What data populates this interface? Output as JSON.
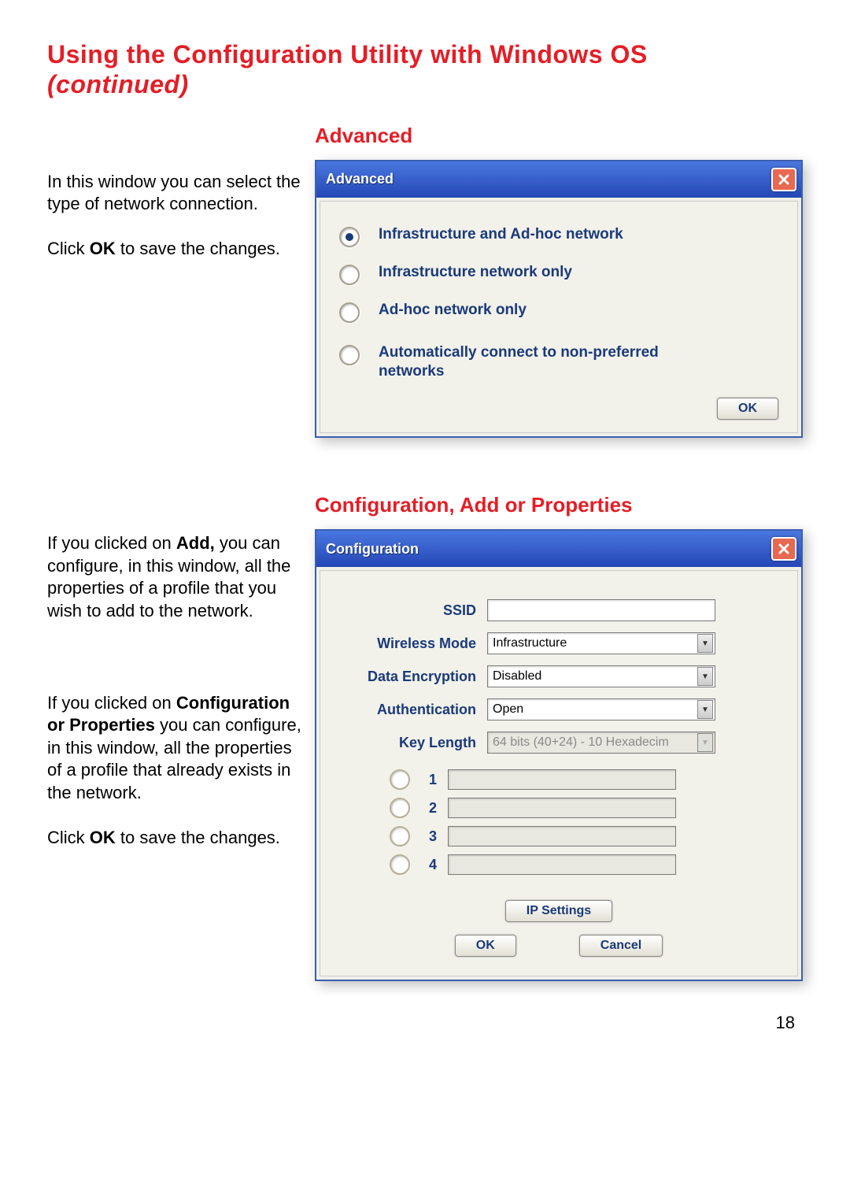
{
  "page": {
    "title_line1": "Using the Configuration Utility with Windows OS",
    "title_line2": "(continued)",
    "number": "18"
  },
  "advanced": {
    "heading": "Advanced",
    "intro_text1": "In this window you can select the type of network connection.",
    "intro_text2a": "Click ",
    "intro_ok": "OK",
    "intro_text2b": " to save the changes.",
    "dialog_title": "Advanced",
    "options": [
      "Infrastructure and Ad-hoc network",
      "Infrastructure  network only",
      "Ad-hoc network only"
    ],
    "option_auto": "Automatically connect to non-preferred networks",
    "ok_button": "OK"
  },
  "config": {
    "heading": "Configuration, Add or Properties",
    "para1_pre": "If you clicked on ",
    "para1_add": "Add,",
    "para1_post": " you can configure, in this window, all the properties of a profile that you wish to add to the network.",
    "para2_pre": "If you clicked on ",
    "para2_cfg": "Configuration or Properties",
    "para2_post": " you can configure, in this window, all the properties of a profile that already exists in the network.",
    "para3_pre": "Click ",
    "para3_ok": "OK",
    "para3_post": " to save the changes.",
    "dialog_title": "Configuration",
    "labels": {
      "ssid": "SSID",
      "wmode": "Wireless Mode",
      "enc": "Data Encryption",
      "auth": "Authentication",
      "klen": "Key Length"
    },
    "values": {
      "ssid": "",
      "wmode": "Infrastructure",
      "enc": "Disabled",
      "auth": "Open",
      "klen": "64 bits (40+24) - 10 Hexadecim"
    },
    "key_numbers": [
      "1",
      "2",
      "3",
      "4"
    ],
    "ip_button": "IP Settings",
    "ok_button": "OK",
    "cancel_button": "Cancel"
  }
}
